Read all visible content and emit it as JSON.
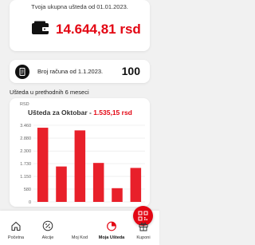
{
  "savings": {
    "title": "Tvoja ukupna ušteda od 01.01.2023.",
    "amount": "14.644,81 rsd",
    "icon": "wallet-icon"
  },
  "accounts": {
    "label": "Broj računa od 1.1.2023.",
    "value": "100",
    "icon": "receipt-icon"
  },
  "section_label": "Ušteda u prethodnih 6 meseci",
  "chart": {
    "unit": "RSD",
    "heading_prefix": "Ušteda za Oktobar - ",
    "heading_value": "1.535,15 rsd"
  },
  "chart_data": {
    "type": "bar",
    "title": "Ušteda za Oktobar - 1.535,15 rsd",
    "ylabel": "RSD",
    "xlabel": "",
    "ylim": [
      0,
      3460
    ],
    "yticks": [
      0,
      580,
      1150,
      1730,
      2300,
      2880,
      3460
    ],
    "ytick_labels": [
      "0",
      "580",
      "1.150",
      "1.730",
      "2.300",
      "2.880",
      "3.460"
    ],
    "categories": [
      "",
      "",
      "",
      "",
      "",
      ""
    ],
    "values": [
      3350,
      1600,
      3230,
      1760,
      620,
      1535
    ],
    "grid": true,
    "color": "#e8202a"
  },
  "nav": {
    "items": [
      {
        "label": "Početna",
        "icon": "home-icon"
      },
      {
        "label": "Akcije",
        "icon": "percent-icon"
      },
      {
        "label": "Moj Kod",
        "icon": "qr-code-icon"
      },
      {
        "label": "Moja Ušteda",
        "icon": "savings-pie-icon"
      },
      {
        "label": "Kuponi",
        "icon": "gift-icon"
      }
    ]
  },
  "colors": {
    "accent": "#e30613",
    "bar": "#e8202a",
    "background": "#f1f1f1"
  }
}
